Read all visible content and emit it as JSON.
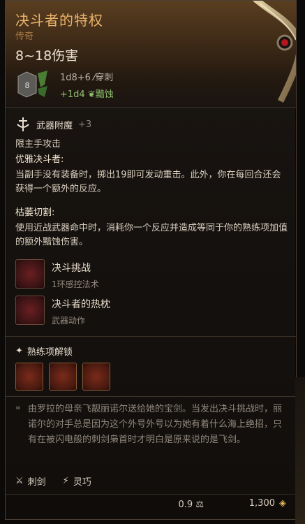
{
  "item": {
    "name": "决斗者的特权",
    "rarity": "传奇",
    "damage_range": "8~18伤害",
    "die_value": "8",
    "damage_main": "1d8+6",
    "damage_type": "穿刺",
    "damage_bonus": "+1d4",
    "bonus_type": "黯蚀"
  },
  "enchant": {
    "label": "武器附魔",
    "value": "+3"
  },
  "traits": {
    "main_hand": "限主手攻击",
    "graceful_title": "优雅决斗者:",
    "graceful_text": "当副手没有装备时，掷出19即可发动重击。此外，你在每回合还会获得一个额外的反应。",
    "wither_title": "枯萎切割:",
    "wither_text": "使用近战武器命中时，消耗你一个反应并造成等同于你的熟练项加值的额外黯蚀伤害。"
  },
  "actions": [
    {
      "name": "决斗挑战",
      "type": "1环感控法术"
    },
    {
      "name": "决斗者的热枕",
      "type": "武器动作"
    }
  ],
  "proficiency": {
    "label": "熟练项解锁"
  },
  "lore": "由罗拉的母亲飞靓丽诺尔送给她的宝剑。当发出决斗挑战时，丽诺尔的对手总是因为这个外号外号以为她有着什么海上绝招，只有在被闪电般的刺剑枭首时才明白是原来说的是飞剑。",
  "properties": [
    {
      "label": "刺剑"
    },
    {
      "label": "灵巧"
    }
  ],
  "footer": {
    "weight": "0.9",
    "price": "1,300"
  },
  "colors": {
    "title": "#e8b26a",
    "rarity": "#a97a44",
    "bonus_damage": "#8fc06f",
    "body_text": "#d8cfbf"
  }
}
